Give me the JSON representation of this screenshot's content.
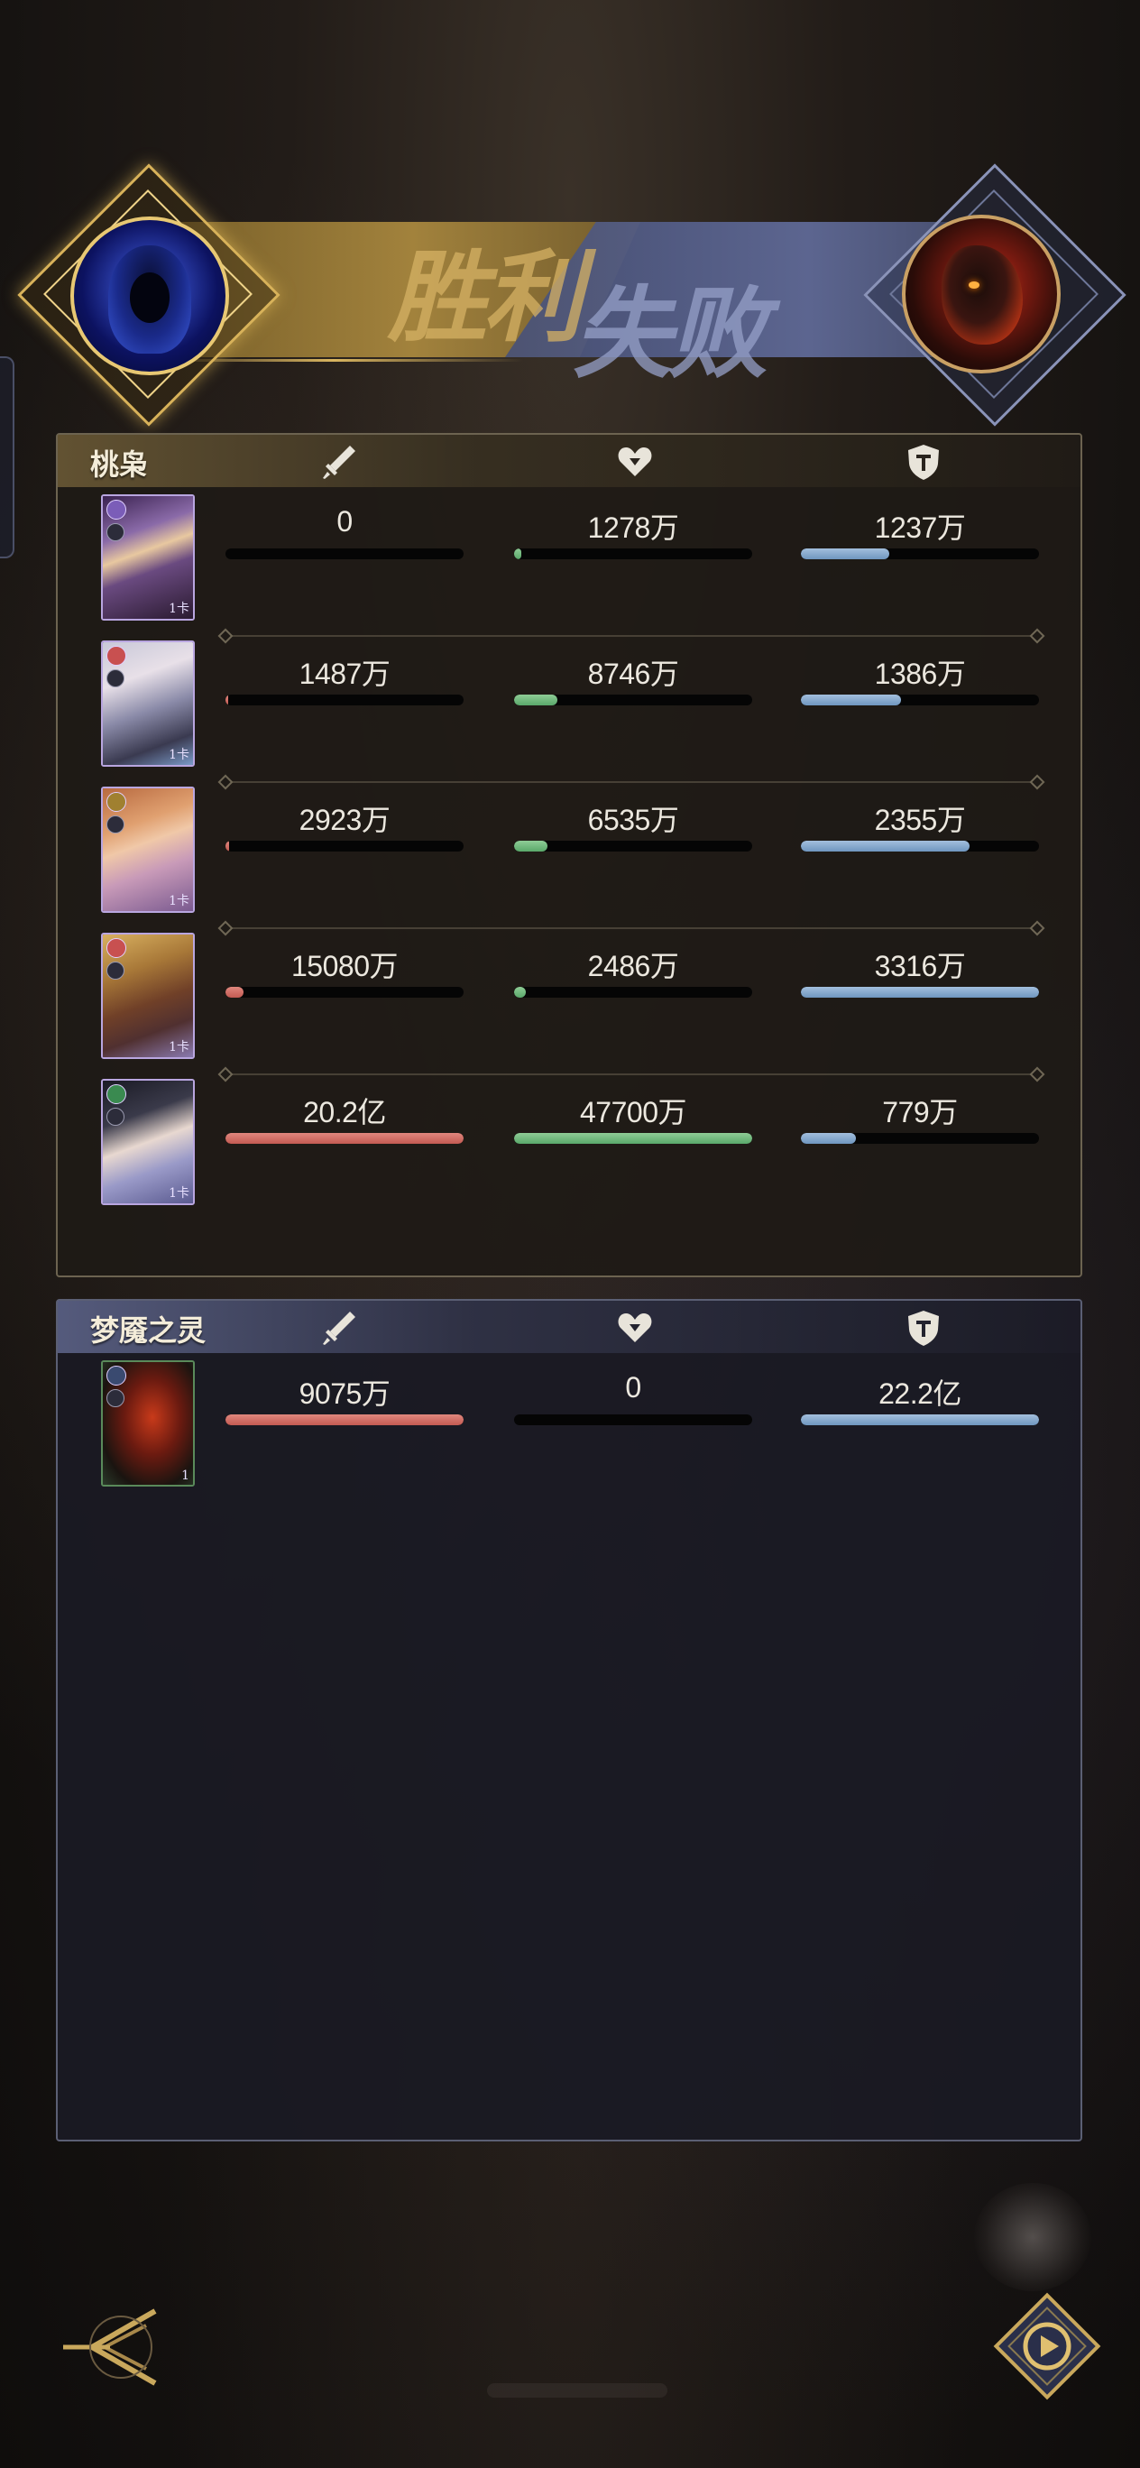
{
  "banner": {
    "victory": "胜利",
    "defeat": "失败",
    "left_portrait": "hooded-mage-portrait",
    "right_portrait": "flame-horse-demon-portrait"
  },
  "ally": {
    "team_name": "桃枭",
    "units": [
      {
        "card_level": "1卡",
        "damage": "0",
        "heal": "1278万",
        "tank": "1237万",
        "damage_pct": 0.0,
        "heal_pct": 0.03,
        "tank_pct": 0.37
      },
      {
        "card_level": "1卡",
        "damage": "1487万",
        "heal": "8746万",
        "tank": "1386万",
        "damage_pct": 0.01,
        "heal_pct": 0.18,
        "tank_pct": 0.42
      },
      {
        "card_level": "1卡",
        "damage": "2923万",
        "heal": "6535万",
        "tank": "2355万",
        "damage_pct": 0.015,
        "heal_pct": 0.14,
        "tank_pct": 0.71
      },
      {
        "card_level": "1卡",
        "damage": "15080万",
        "heal": "2486万",
        "tank": "3316万",
        "damage_pct": 0.075,
        "heal_pct": 0.05,
        "tank_pct": 1.0
      },
      {
        "card_level": "1卡",
        "damage": "20.2亿",
        "heal": "47700万",
        "tank": "779万",
        "damage_pct": 1.0,
        "heal_pct": 1.0,
        "tank_pct": 0.23
      }
    ]
  },
  "enemy": {
    "team_name": "梦魇之灵",
    "units": [
      {
        "card_level": "1",
        "damage": "9075万",
        "heal": "0",
        "tank": "22.2亿",
        "damage_pct": 1.0,
        "heal_pct": 0.0,
        "tank_pct": 1.0
      }
    ]
  },
  "icons": {
    "damage": "sword-icon",
    "heal": "heart-icon",
    "tank": "shield-icon",
    "back": "back-arrow-icon",
    "replay": "replay-icon"
  },
  "colors": {
    "damage": "#c35a52",
    "heal": "#5aa86a",
    "tank": "#6f96bf",
    "gold_accent": "#d8b25a",
    "blue_accent": "#8a93b8"
  }
}
